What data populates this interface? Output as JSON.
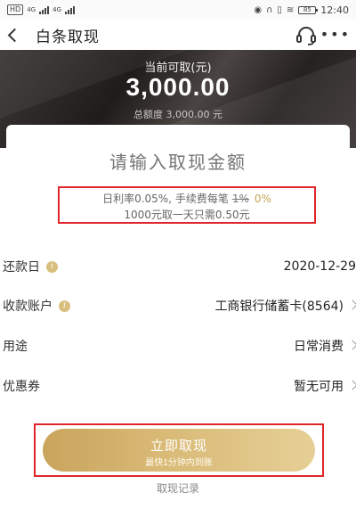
{
  "status_bar": {
    "left_box": "HD",
    "net1": "4G",
    "net2": "4G",
    "battery": "85",
    "time": "12:40"
  },
  "nav": {
    "title": "白条取现"
  },
  "hero": {
    "label": "当前可取(元)",
    "amount": "3,000.00",
    "total": "总额度 3,000.00 元"
  },
  "input": {
    "placeholder": "请输入取现金额"
  },
  "rate": {
    "prefix": "日利率0.05%, 手续费每笔",
    "original_fee": "1%",
    "current_fee": "0%",
    "note": "1000元取一天只需0.50元"
  },
  "rows": [
    {
      "label": "还款日",
      "value": "2020-12-29"
    },
    {
      "label": "收款账户",
      "value": "工商银行储蓄卡(8564)"
    },
    {
      "label": "用途",
      "value": "日常消费"
    },
    {
      "label": "优惠券",
      "value": "暂无可用"
    }
  ],
  "button": {
    "title": "立即取现",
    "subtitle": "最快1分钟内到账"
  },
  "record_link": "取现记录",
  "colors": {
    "accent_gold": "#d8b874",
    "highlight_red": "#e0252a",
    "hero_dark": "#2a2625"
  }
}
